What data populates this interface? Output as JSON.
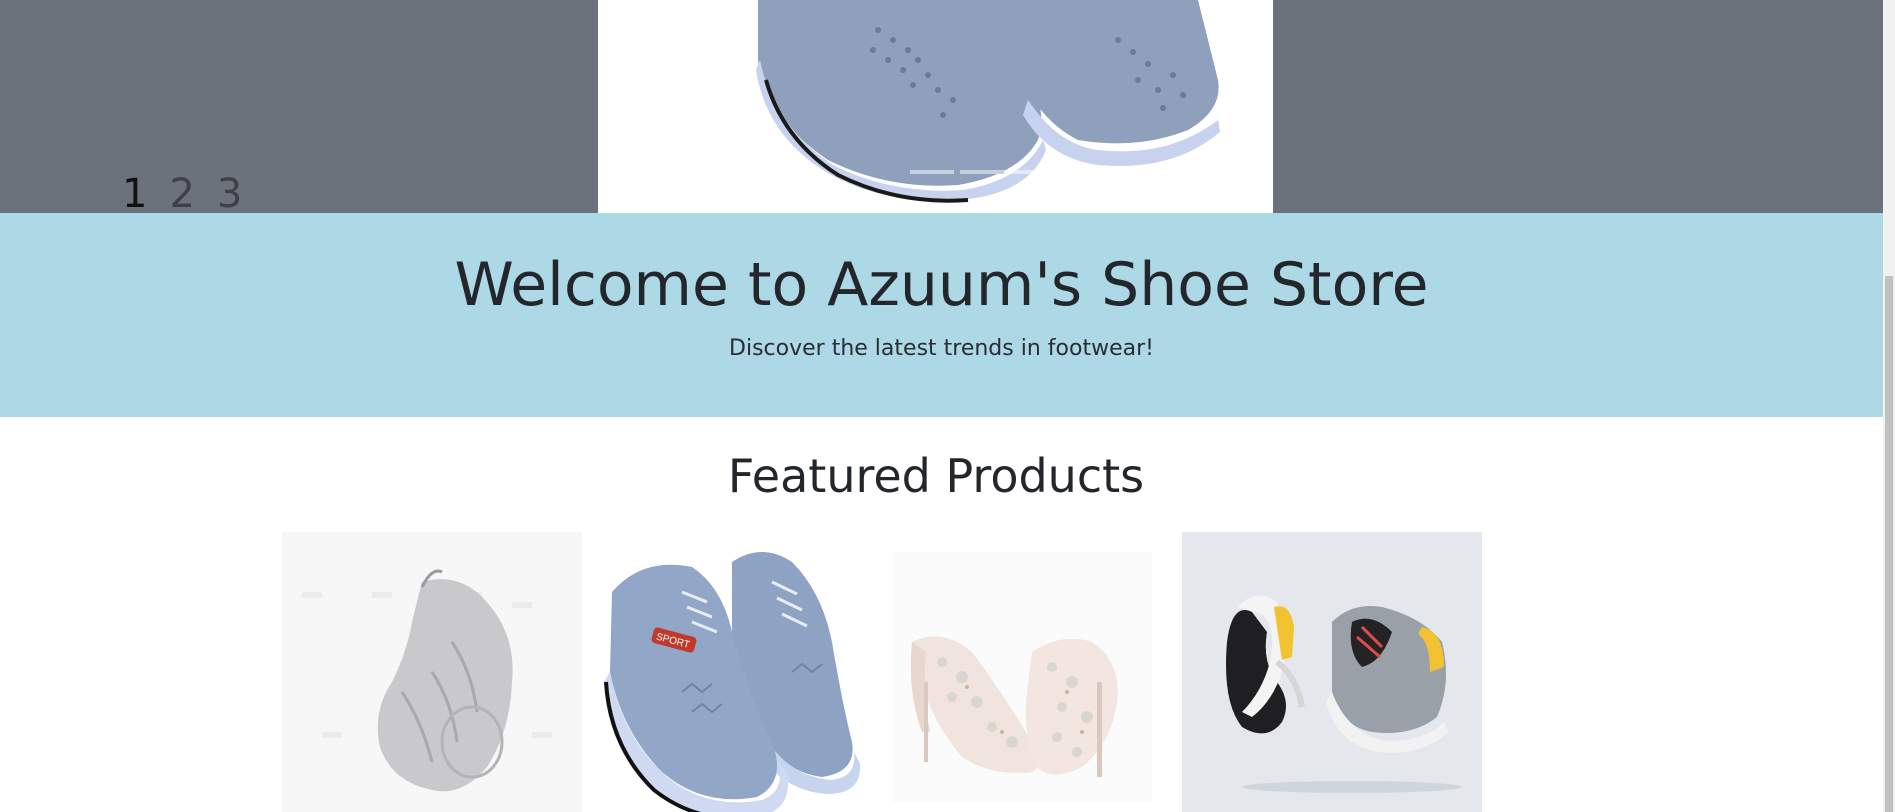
{
  "carousel": {
    "pager": [
      "1",
      "2",
      "3"
    ],
    "active_page": 1,
    "slide_count": 3,
    "active_slide": 2
  },
  "hero": {
    "title": "Welcome to Azuum's Shoe Store",
    "subtitle": "Discover the latest trends in footwear!",
    "background_color": "#add8e6"
  },
  "featured": {
    "title": "Featured Products",
    "products": [
      {
        "image": "white-chunky-sneaker"
      },
      {
        "image": "blue-knit-sport-sneakers"
      },
      {
        "image": "crystal-embellished-heels"
      },
      {
        "image": "gray-yellow-running-shoes"
      }
    ]
  },
  "colors": {
    "carousel_bg": "#6c727c",
    "hero_bg": "#add8e6",
    "text": "#212529"
  }
}
